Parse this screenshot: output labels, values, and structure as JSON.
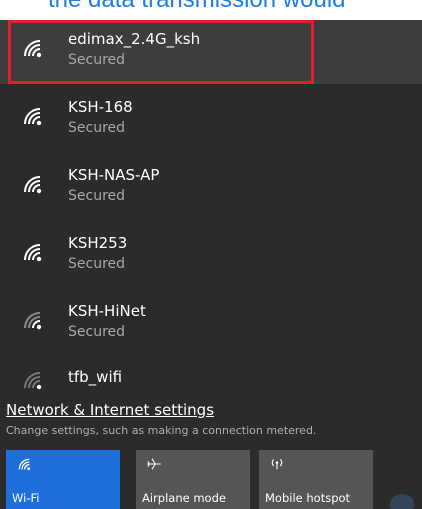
{
  "caption": {
    "text": "the data transmission would"
  },
  "networks": [
    {
      "name": "edimax_2.4G_ksh",
      "status": "Secured"
    },
    {
      "name": "KSH-168",
      "status": "Secured"
    },
    {
      "name": "KSH-NAS-AP",
      "status": "Secured"
    },
    {
      "name": "KSH253",
      "status": "Secured"
    },
    {
      "name": "KSH-HiNet",
      "status": "Secured"
    },
    {
      "name": "tfb_wifi",
      "status": ""
    }
  ],
  "settings": {
    "link": "Network & Internet settings",
    "description": "Change settings, such as making a connection metered."
  },
  "quick_actions": [
    {
      "label": "Wi-Fi",
      "icon": "wifi-icon",
      "active": true
    },
    {
      "label": "Airplane mode",
      "icon": "airplane-icon",
      "active": false
    },
    {
      "label": "Mobile hotspot",
      "icon": "hotspot-icon",
      "active": false
    }
  ],
  "colors": {
    "highlight": "#e0202a",
    "accent": "#1e6fd9",
    "caption": "#1f7de0"
  }
}
